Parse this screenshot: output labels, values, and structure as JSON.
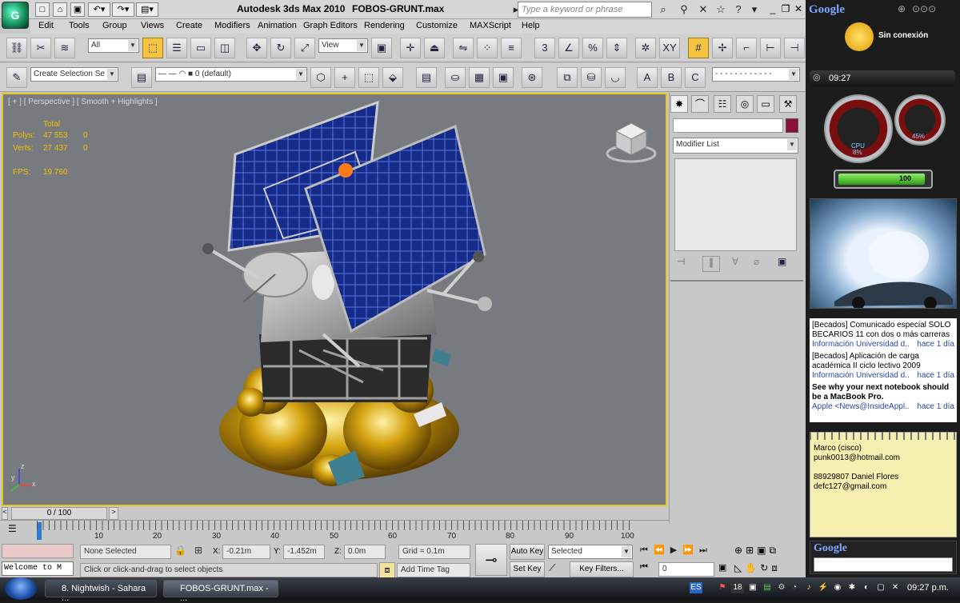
{
  "title": {
    "app": "Autodesk 3ds Max  2010",
    "file": "FOBOS-GRUNT.max",
    "search_placeholder": "Type a keyword or phrase"
  },
  "menu": [
    "Edit",
    "Tools",
    "Group",
    "Views",
    "Create",
    "Modifiers",
    "Animation",
    "Graph Editors",
    "Rendering",
    "Customize",
    "MAXScript",
    "Help"
  ],
  "toolbar": {
    "selection_filter": "All",
    "ref_coord": "View",
    "create_selection_set": "Create Selection Se",
    "layer": "0 (default)",
    "snap_labels": [
      "3",
      "%",
      "XY"
    ],
    "named_sel_labels": [
      "A",
      "B",
      "C"
    ]
  },
  "viewport": {
    "label": "[ + ] [ Perspective ] [ Smooth + Highlights ]",
    "stats_header": "Total",
    "polys_label": "Polys:",
    "polys_value": "47 553",
    "polys_sel": "0",
    "verts_label": "Verts:",
    "verts_value": "27 437",
    "verts_sel": "0",
    "fps_label": "FPS:",
    "fps_value": "19.760",
    "axis_z": "z",
    "axis_y": "y",
    "axis_x": "x"
  },
  "command_panel": {
    "modifier_list": "Modifier List"
  },
  "timeline": {
    "position": "0 / 100",
    "ticks": [
      "10",
      "20",
      "30",
      "40",
      "50",
      "60",
      "70",
      "80",
      "90",
      "100"
    ]
  },
  "status": {
    "selection": "None Selected",
    "x_label": "X:",
    "x_value": "-0.21m",
    "y_label": "Y:",
    "y_value": "-1.452m",
    "z_label": "Z:",
    "z_value": "0.0m",
    "grid": "Grid = 0.1m",
    "prompt": "Click or click-and-drag to select objects",
    "add_time_tag": "Add Time Tag",
    "auto_key": "Auto Key",
    "set_key": "Set Key",
    "key_mode": "Selected",
    "key_filters": "Key Filters...",
    "frame": "0",
    "maxscript": "Welcome to M"
  },
  "sidebar": {
    "google": "Google",
    "weather": "Sin conexión",
    "time": "09:27",
    "cpu_label": "CPU",
    "cpu_value": "8%",
    "mem_value": "45%",
    "battery": "100",
    "news": [
      {
        "title": "[Becados] Comunicado especial SOLO BECARIOS 11 con dos o más carreras",
        "source": "Información Universidad d..",
        "time": "hace 1 día"
      },
      {
        "title": "[Becados] Aplicación de carga académica II ciclo lectivo 2009",
        "source": "Información Universidad d..",
        "time": "hace 1 día"
      },
      {
        "title": "See why your next notebook should be a MacBook Pro.",
        "source": "Apple <News@InsideAppl..",
        "time": "hace 1 día"
      }
    ],
    "notes": [
      "Marco (cisco)",
      "punk0013@hotmail.com",
      "",
      "88929807 Daniel Flores",
      "defc127@gmail.com"
    ],
    "google_bottom": "Google"
  },
  "taskbar": {
    "tasks": [
      "8. Nightwish - Sahara ...",
      "FOBOS-GRUNT.max - ..."
    ],
    "lang": "ES",
    "tray_badge": "18",
    "clock": "09:27 p.m."
  }
}
